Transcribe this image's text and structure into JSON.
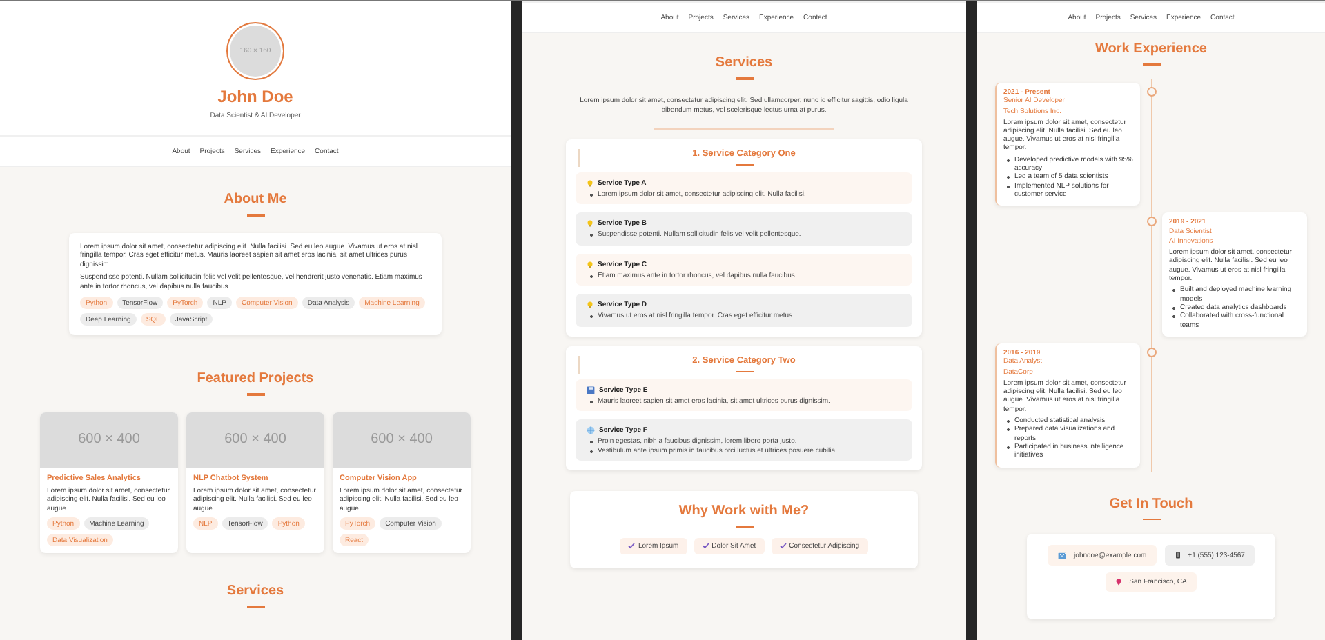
{
  "panels": [
    {
      "sections": [
        {
          "kind": "hero",
          "avatar_label": "160 × 160",
          "name": "John Doe",
          "subtitle": "Data Scientist & AI Developer"
        },
        {
          "kind": "nav",
          "items": [
            "About",
            "Projects",
            "Services",
            "Experience",
            "Contact"
          ]
        },
        {
          "kind": "about",
          "title": "About Me",
          "paragraphs": [
            "Lorem ipsum dolor sit amet, consectetur adipiscing elit. Nulla facilisi. Sed eu leo augue. Vivamus ut eros at nisl fringilla tempor. Cras eget efficitur metus. Mauris laoreet sapien sit amet eros lacinia, sit amet ultrices purus dignissim.",
            "Suspendisse potenti. Nullam sollicitudin felis vel velit pellentesque, vel hendrerit justo venenatis. Etiam maximus ante in tortor rhoncus, vel dapibus nulla faucibus."
          ],
          "tags": [
            {
              "label": "Python",
              "kind": "accent"
            },
            {
              "label": "TensorFlow",
              "kind": "plain"
            },
            {
              "label": "PyTorch",
              "kind": "accent"
            },
            {
              "label": "NLP",
              "kind": "plain"
            },
            {
              "label": "Computer Vision",
              "kind": "accent"
            },
            {
              "label": "Data Analysis",
              "kind": "plain"
            },
            {
              "label": "Machine Learning",
              "kind": "accent"
            },
            {
              "label": "Deep Learning",
              "kind": "plain"
            },
            {
              "label": "SQL",
              "kind": "accent"
            },
            {
              "label": "JavaScript",
              "kind": "plain"
            }
          ]
        },
        {
          "kind": "projects",
          "title": "Featured Projects",
          "projects": [
            {
              "image_label": "600 × 400",
              "title": "Predictive Sales Analytics",
              "description": "Lorem ipsum dolor sit amet, consectetur adipiscing elit. Nulla facilisi. Sed eu leo augue.",
              "tags": [
                {
                  "label": "Python",
                  "kind": "accent"
                },
                {
                  "label": "Machine Learning",
                  "kind": "plain"
                },
                {
                  "label": "Data Visualization",
                  "kind": "accent"
                }
              ]
            },
            {
              "image_label": "600 × 400",
              "title": "NLP Chatbot System",
              "description": "Lorem ipsum dolor sit amet, consectetur adipiscing elit. Nulla facilisi. Sed eu leo augue.",
              "tags": [
                {
                  "label": "NLP",
                  "kind": "accent"
                },
                {
                  "label": "TensorFlow",
                  "kind": "plain"
                },
                {
                  "label": "Python",
                  "kind": "accent"
                }
              ]
            },
            {
              "image_label": "600 × 400",
              "title": "Computer Vision App",
              "description": "Lorem ipsum dolor sit amet, consectetur adipiscing elit. Nulla facilisi. Sed eu leo augue.",
              "tags": [
                {
                  "label": "PyTorch",
                  "kind": "accent"
                },
                {
                  "label": "Computer Vision",
                  "kind": "plain"
                },
                {
                  "label": "React",
                  "kind": "accent"
                }
              ]
            }
          ]
        },
        {
          "kind": "heading",
          "title": "Services"
        }
      ]
    },
    {
      "sections": [
        {
          "kind": "nav",
          "items": [
            "About",
            "Projects",
            "Services",
            "Experience",
            "Contact"
          ]
        },
        {
          "kind": "services",
          "title": "Services",
          "intro": "Lorem ipsum dolor sit amet, consectetur adipiscing elit. Sed ullamcorper, nunc id efficitur sagittis, odio ligula bibendum metus, vel scelerisque lectus urna at purus.",
          "categories": [
            {
              "title": "1. Service Category One",
              "services": [
                {
                  "name": "Service Type A",
                  "kind": "warm",
                  "points": [
                    "Lorem ipsum dolor sit amet, consectetur adipiscing elit. Nulla facilisi."
                  ]
                },
                {
                  "name": "Service Type B",
                  "kind": "gray",
                  "points": [
                    "Suspendisse potenti. Nullam sollicitudin felis vel velit pellentesque."
                  ]
                },
                {
                  "name": "Service Type C",
                  "kind": "warm",
                  "points": [
                    "Etiam maximus ante in tortor rhoncus, vel dapibus nulla faucibus."
                  ]
                },
                {
                  "name": "Service Type D",
                  "kind": "gray",
                  "points": [
                    "Vivamus ut eros at nisl fringilla tempor. Cras eget efficitur metus."
                  ]
                }
              ]
            },
            {
              "title": "2. Service Category Two",
              "services": [
                {
                  "name": "Service Type E",
                  "kind": "warm",
                  "points": [
                    "Mauris laoreet sapien sit amet eros lacinia, sit amet ultrices purus dignissim."
                  ]
                },
                {
                  "name": "Service Type F",
                  "kind": "gray",
                  "points": [
                    "Proin egestas, nibh a faucibus dignissim, lorem libero porta justo.",
                    "Vestibulum ante ipsum primis in faucibus orci luctus et ultrices posuere cubilia."
                  ]
                }
              ]
            }
          ]
        },
        {
          "kind": "why",
          "title": "Why Work with Me?",
          "points": [
            "Lorem Ipsum",
            "Dolor Sit Amet",
            "Consectetur Adipiscing"
          ]
        }
      ]
    },
    {
      "sections": [
        {
          "kind": "nav",
          "items": [
            "About",
            "Projects",
            "Services",
            "Experience",
            "Contact"
          ]
        },
        {
          "kind": "experience",
          "title": "Work Experience",
          "jobs": [
            {
              "period": "2021 - Present",
              "role": "Senior AI Developer",
              "company": "Tech Solutions Inc.",
              "description": "Lorem ipsum dolor sit amet, consectetur adipiscing elit. Nulla facilisi. Sed eu leo augue. Vivamus ut eros at nisl fringilla tempor.",
              "achievements": [
                "Developed predictive models with 95% accuracy",
                "Led a team of 5 data scientists",
                "Implemented NLP solutions for customer service"
              ]
            },
            {
              "period": "2019 - 2021",
              "role": "Data Scientist",
              "company": "AI Innovations",
              "description": "Lorem ipsum dolor sit amet, consectetur adipiscing elit. Nulla facilisi. Sed eu leo augue. Vivamus ut eros at nisl fringilla tempor.",
              "achievements": [
                "Built and deployed machine learning models",
                "Created data analytics dashboards",
                "Collaborated with cross-functional teams"
              ]
            },
            {
              "period": "2016 - 2019",
              "role": "Data Analyst",
              "company": "DataCorp",
              "description": "Lorem ipsum dolor sit amet, consectetur adipiscing elit. Nulla facilisi. Sed eu leo augue. Vivamus ut eros at nisl fringilla tempor.",
              "achievements": [
                "Conducted statistical analysis",
                "Prepared data visualizations and reports",
                "Participated in business intelligence initiatives"
              ]
            }
          ]
        },
        {
          "kind": "contact",
          "title": "Get In Touch",
          "items": [
            {
              "text": "johndoe@example.com",
              "kind": "warm"
            },
            {
              "text": "+1 (555) 123-4567",
              "kind": "gray"
            },
            {
              "text": "San Francisco, CA",
              "kind": "warm"
            }
          ]
        }
      ]
    }
  ]
}
